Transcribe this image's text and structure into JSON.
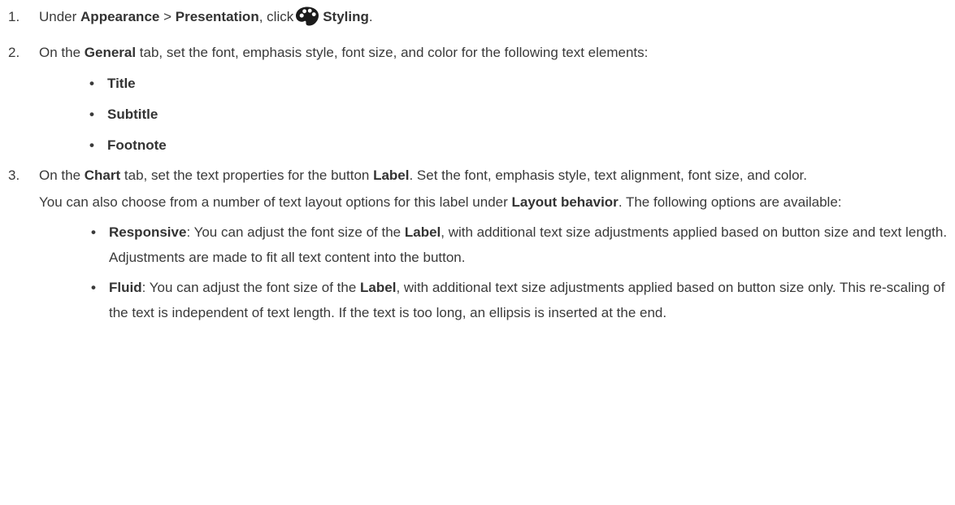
{
  "steps": [
    {
      "num": "1.",
      "pre": "Under ",
      "b1": "Appearance",
      "sep": " > ",
      "b2": "Presentation",
      "mid": ", click",
      "icon": "palette-icon",
      "b3": "Styling",
      "end": "."
    },
    {
      "num": "2.",
      "pre": "On the ",
      "b1": "General",
      "post": " tab, set the font, emphasis style, font size, and color for the following text elements:",
      "items": [
        "Title",
        "Subtitle",
        "Footnote"
      ]
    },
    {
      "num": "3.",
      "pre": "On the ",
      "b1": "Chart",
      "mid": " tab, set the text properties for the button ",
      "b2": "Label",
      "post": ". Set the font, emphasis style, text alignment, font size, and color.",
      "para_pre": "You can also choose from a number of text layout options for this label under ",
      "para_b": "Layout behavior",
      "para_post": ". The following options are available:",
      "options": [
        {
          "name": "Responsive",
          "t1": ": You can adjust the font size of the ",
          "label": "Label",
          "t2": ", with additional text size adjustments applied based on button size and text length. Adjustments are made to fit all text content into the button."
        },
        {
          "name": "Fluid",
          "t1": ": You can adjust the font size of the ",
          "label": "Label",
          "t2": ", with additional text size adjustments applied based on button size only. This re-scaling of the text is independent of text length. If the text is too long, an ellipsis is inserted at the end."
        }
      ]
    }
  ],
  "bullet_char": "•"
}
